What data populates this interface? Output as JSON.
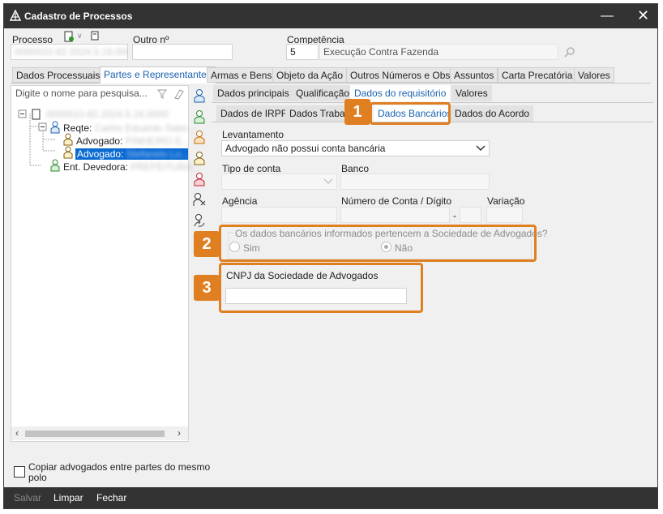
{
  "window": {
    "title": "Cadastro de Processos"
  },
  "header": {
    "processo_label": "Processo",
    "processo_value": "0000010-82.2024.5.16.0000",
    "outro_label": "Outro nº",
    "outro_value": "",
    "competencia_label": "Competência",
    "competencia_code": "5",
    "competencia_desc": "Execução Contra Fazenda"
  },
  "main_tabs": [
    "Dados Processuais",
    "Partes e Representantes",
    "Armas e Bens",
    "Objeto da Ação",
    "Outros Números e Obs.",
    "Assuntos",
    "Carta Precatória",
    "Valores"
  ],
  "left_panel": {
    "search_placeholder": "Digite o nome para pesquisa...",
    "tree": {
      "root": "0000010-82.2024.5.16.0000",
      "reqte_label": "Reqte:",
      "reqte_name": "Carlos Eduardo Sabó...",
      "adv1_label": "Advogado:",
      "adv1_name": "PINHEIRO E...",
      "adv2_label": "Advogado:",
      "adv2_name": "Stefanelo Lo...",
      "dev_label": "Ent. Devedora:",
      "dev_name": "PREFEITURA..."
    },
    "copy_label": "Copiar advogados entre partes do mesmo polo"
  },
  "sub_tabs": [
    "Dados principais",
    "Qualificação",
    "Dados do requisitório",
    "Valores"
  ],
  "sub_sub_tabs": [
    "Dados de IRPF",
    "Dados Trabal",
    "Dados Bancários",
    "Dados do Acordo"
  ],
  "form": {
    "levantamento_label": "Levantamento",
    "levantamento_value": "Advogado não possui conta bancária",
    "tipo_conta_label": "Tipo de conta",
    "banco_label": "Banco",
    "agencia_label": "Agência",
    "conta_label": "Número de Conta / Dígito",
    "variacao_label": "Variação",
    "dash": "-",
    "pertencem_label": "Os dados bancários informados pertencem a Sociedade de Advogados?",
    "sim_label": "Sim",
    "nao_label": "Não",
    "cnpj_label": "CNPJ da Sociedade de Advogados"
  },
  "badges": [
    "1",
    "2",
    "3"
  ],
  "footer": {
    "salvar": "Salvar",
    "limpar": "Limpar",
    "fechar": "Fechar"
  },
  "colors": {
    "accent": "#e07f22",
    "selection": "#0a6ad2",
    "titlebar": "#333333",
    "active_tab_text": "#1a62b0"
  }
}
